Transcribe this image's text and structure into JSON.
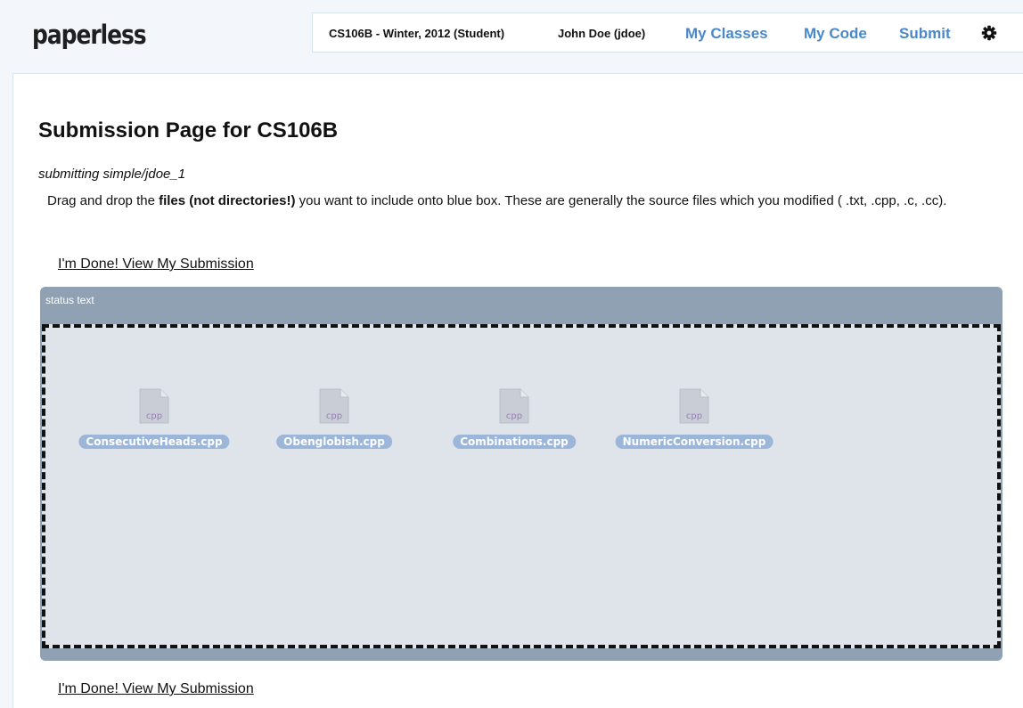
{
  "brand": {
    "logo_text": "paperless"
  },
  "nav": {
    "course": "CS106B - Winter, 2012 (Student)",
    "user": "John Doe (jdoe)",
    "my_classes": "My Classes",
    "my_code": "My Code",
    "submit": "Submit",
    "settings_icon": "gear-icon"
  },
  "page": {
    "title": "Submission Page for CS106B",
    "submitting_label": "submitting simple/jdoe_1",
    "instructions": {
      "prefix": "Drag and drop the ",
      "bold": "files (not directories!)",
      "suffix": " you want to include onto blue box. These are generally the source files which you modified ( .txt, .cpp, .c, .cc)."
    },
    "done_link_top": "I'm Done! View My Submission",
    "done_link_bottom": "I'm Done! View My Submission"
  },
  "upload": {
    "status_text": "status text",
    "files": [
      {
        "name": "ConsecutiveHeads.cpp",
        "ext": "cpp",
        "icon": "cpp-file-icon"
      },
      {
        "name": "Obenglobish.cpp",
        "ext": "cpp",
        "icon": "cpp-file-icon"
      },
      {
        "name": "Combinations.cpp",
        "ext": "cpp",
        "icon": "cpp-file-icon"
      },
      {
        "name": "NumericConversion.cpp",
        "ext": "cpp",
        "icon": "cpp-file-icon"
      }
    ]
  },
  "colors": {
    "nav_link": "#4a88c9",
    "panel": "#8fa1b3",
    "drop_zone": "#dfe3ea",
    "file_label": "#9bb6d9",
    "file_ext": "#9b79b8"
  }
}
